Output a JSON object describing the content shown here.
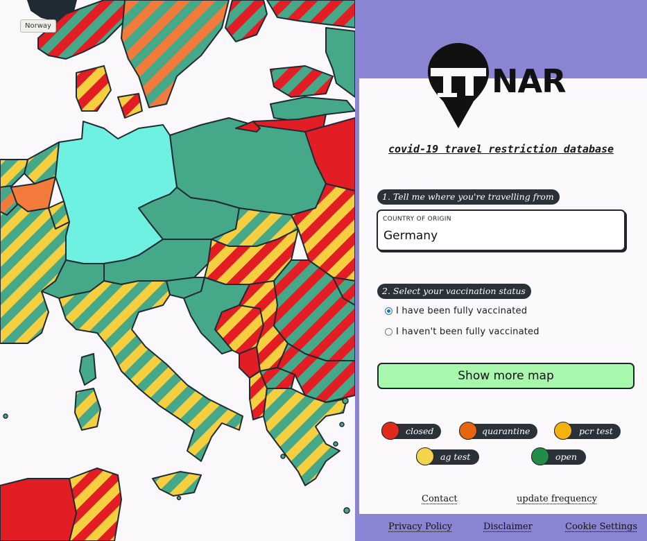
{
  "map": {
    "tooltip": "Norway",
    "colors": {
      "closed": "#e21d24",
      "quarantine": "#f27b3b",
      "pcr_test": "#f2c331",
      "ag_test": "#f5d142",
      "open": "#44a889",
      "selected_origin": "#6ff1e2",
      "sea": "#fbf8fb",
      "border": "#1f2a33"
    }
  },
  "panel": {
    "logo_text": "NAR",
    "subtitle": "covid-19 travel restriction database",
    "step1": "1. Tell me where you're travelling from",
    "origin_label": "COUNTRY OF ORIGIN",
    "origin_value": "Germany",
    "step2": "2. Select your vaccination status",
    "radio_vaccinated": "I have been fully vaccinated",
    "radio_not_vaccinated": "I haven't been fully vaccinated",
    "map_button": "Show more map"
  },
  "legend": [
    {
      "label": "closed",
      "color": "#df2b1c"
    },
    {
      "label": "quarantine",
      "color": "#e5640d"
    },
    {
      "label": "pcr test",
      "color": "#f4b20f"
    },
    {
      "label": "ag test",
      "color": "#f4d44a"
    },
    {
      "label": "open",
      "color": "#238c47"
    }
  ],
  "links": {
    "contact": "Contact",
    "update_frequency": "update frequency",
    "privacy": "Privacy Policy",
    "disclaimer": "Disclaimer",
    "cookies": "Cookie Settings"
  }
}
